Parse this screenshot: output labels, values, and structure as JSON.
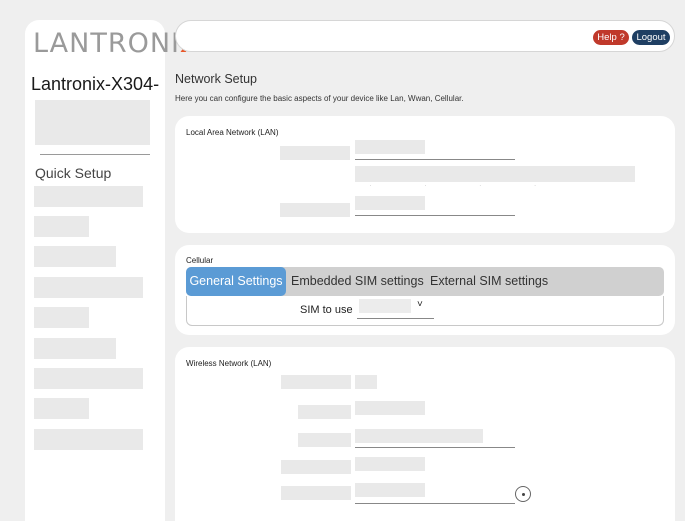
{
  "sidebar": {
    "logo_main": "LANTRONI",
    "logo_accent": "X",
    "device_name": "Lantronix-X304-",
    "section_label": "Quick Setup"
  },
  "header": {
    "help_label": "Help ?",
    "logout_label": "Logout"
  },
  "page": {
    "title": "Network Setup",
    "subtitle": "Here you can configure the basic aspects of your device like Lan, Wwan, Cellular."
  },
  "lan": {
    "title": "Local Area Network (LAN)"
  },
  "cellular": {
    "title": "Cellular",
    "tabs": [
      "General Settings",
      "Embedded SIM settings",
      "External SIM settings"
    ],
    "sim_label": "SIM to use"
  },
  "wireless": {
    "title": "Wireless Network (LAN)"
  },
  "icons": {
    "dropdown": "chevron-down-icon",
    "reveal": "eye-icon"
  },
  "colors": {
    "accent_tab": "#5b9bd5",
    "help_button": "#c0392b",
    "logout_button": "#1f3f63",
    "logo_accent": "#e8572a"
  }
}
